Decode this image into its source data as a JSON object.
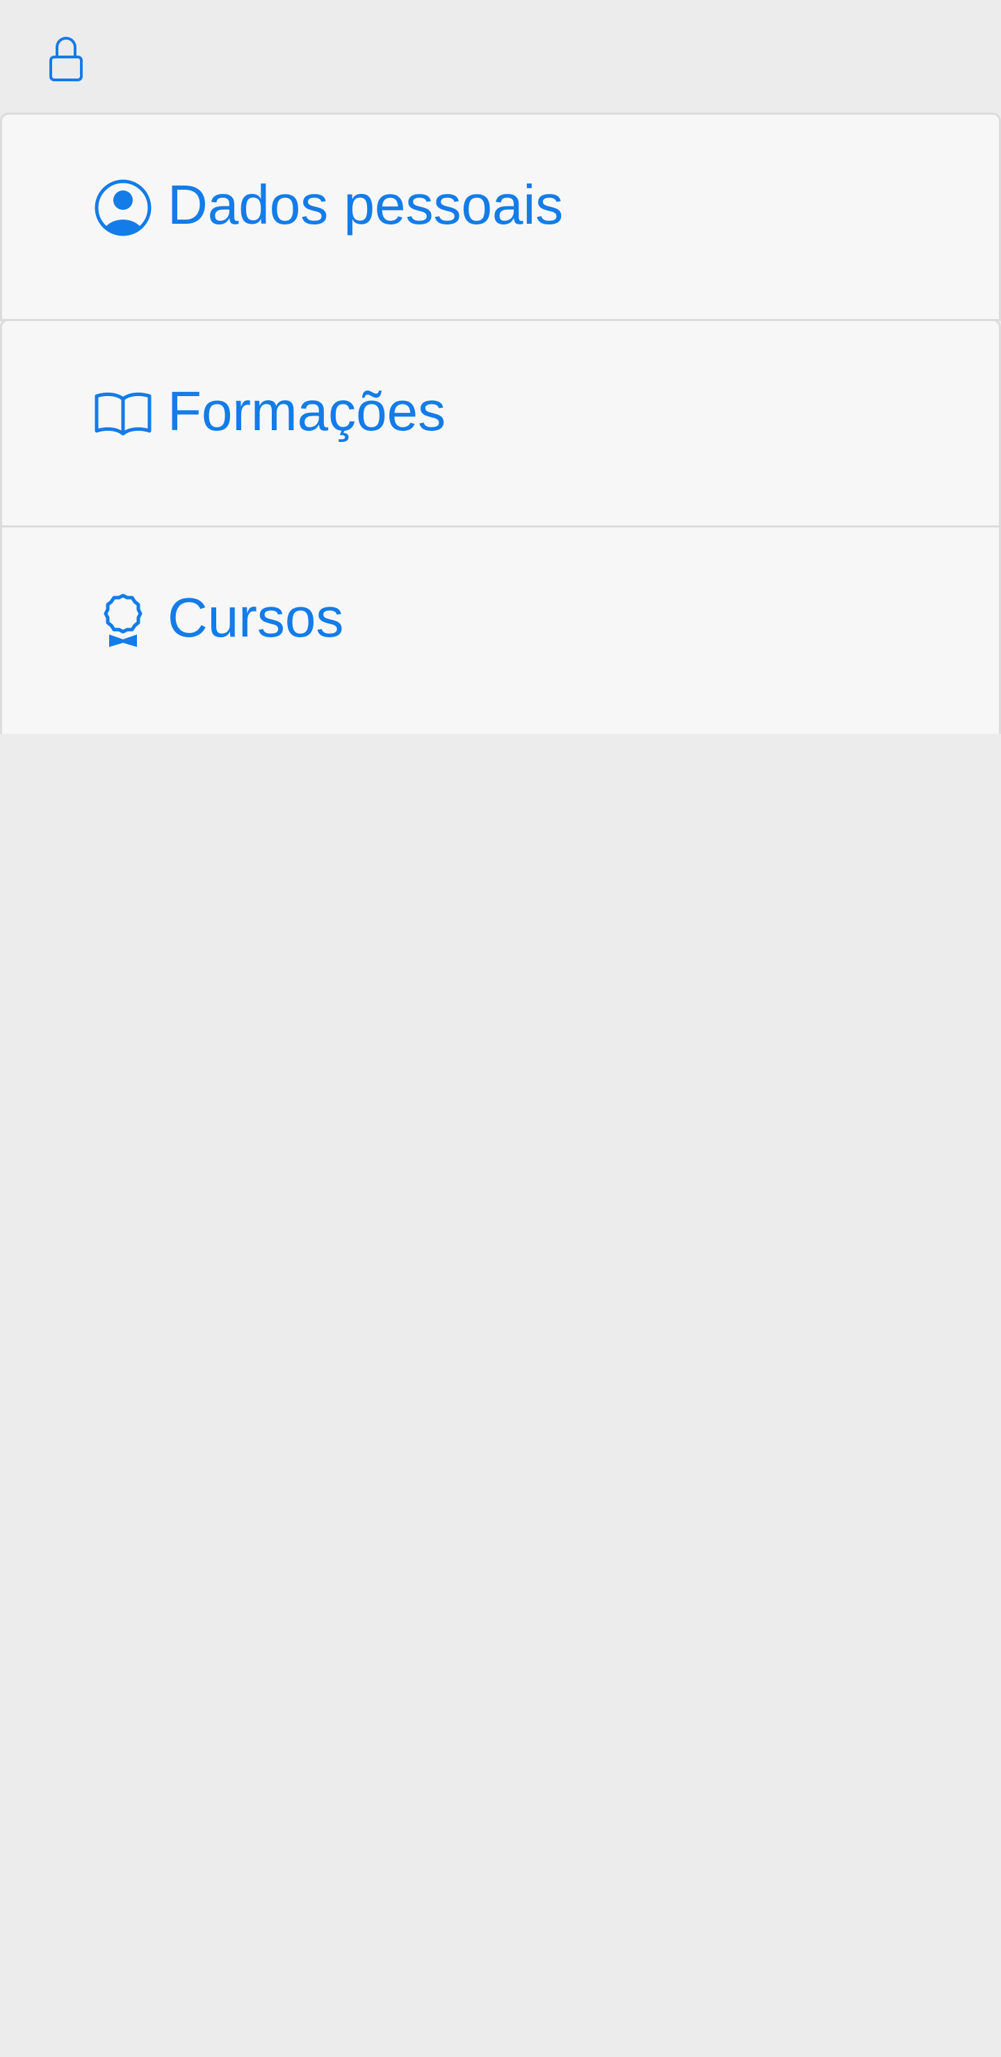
{
  "colors": {
    "accent": "#137ce8",
    "background": "#ececec",
    "item_background": "#f7f7f7",
    "border": "#dcdcdc"
  },
  "header": {
    "icon": "lock-icon"
  },
  "menu": {
    "items": [
      {
        "label": "Dados pessoais",
        "icon": "user-circle-icon"
      },
      {
        "label": "Formações",
        "icon": "open-book-icon"
      },
      {
        "label": "Cursos",
        "icon": "award-icon"
      }
    ]
  }
}
